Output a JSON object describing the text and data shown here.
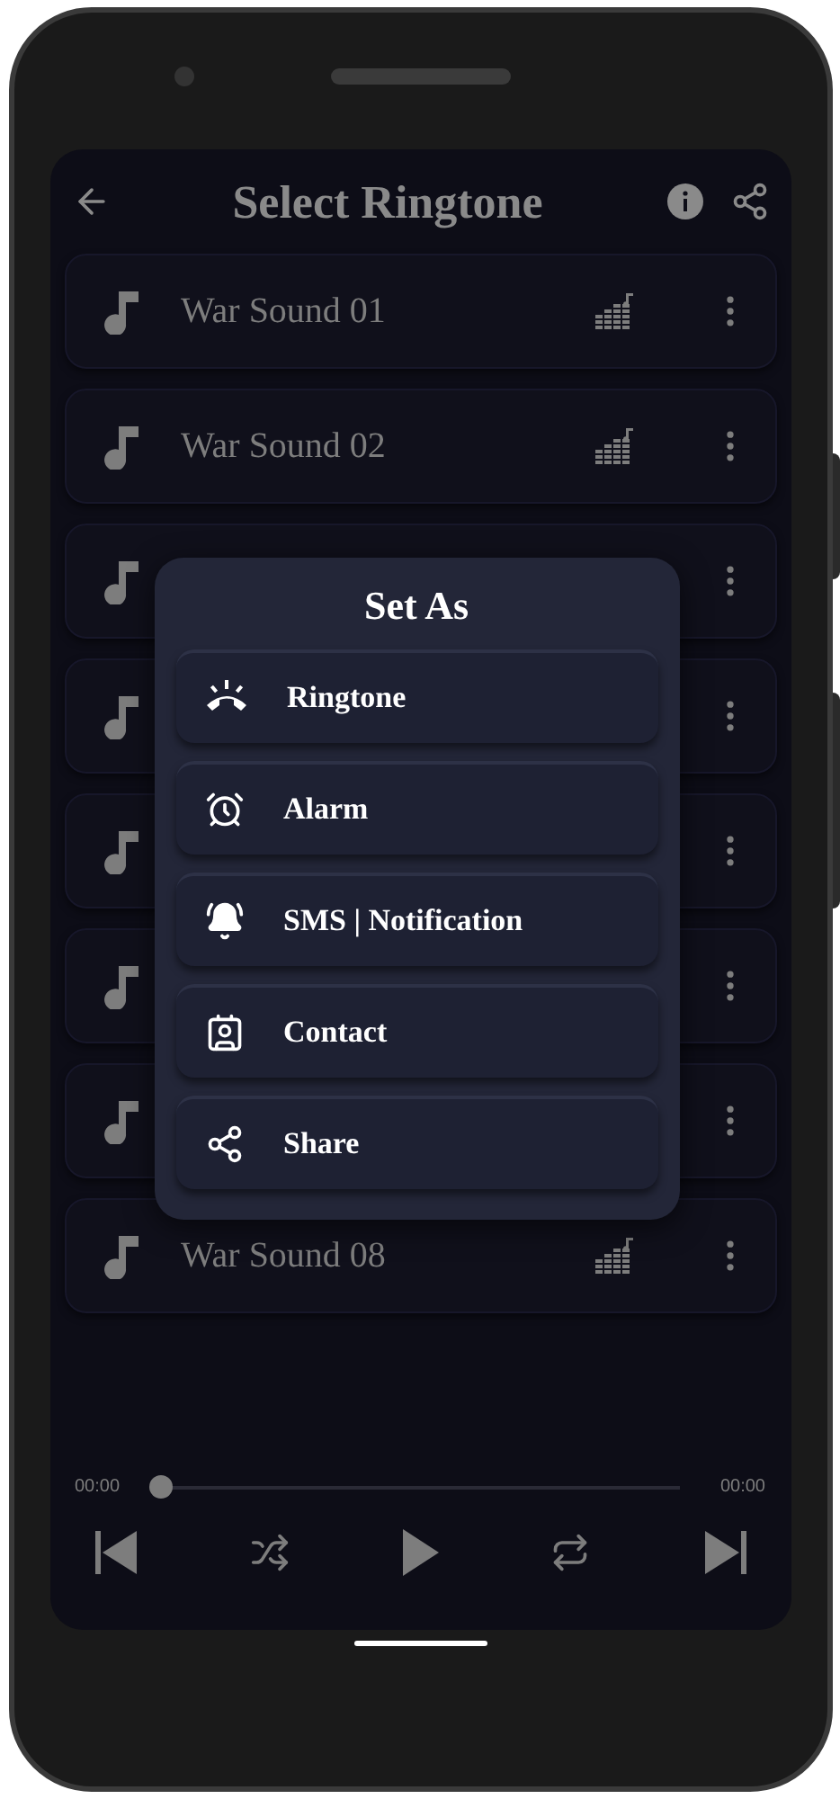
{
  "header": {
    "title": "Select Ringtone"
  },
  "rows": [
    {
      "name": "War Sound 01"
    },
    {
      "name": "War Sound 02"
    },
    {},
    {},
    {},
    {},
    {},
    {
      "name": "War Sound 08"
    }
  ],
  "dialog": {
    "title": "Set As",
    "options": [
      {
        "kind": "ringtone",
        "label": "Ringtone"
      },
      {
        "kind": "alarm",
        "label": "Alarm"
      },
      {
        "kind": "notification",
        "label": "SMS | Notification"
      },
      {
        "kind": "contact",
        "label": "Contact"
      },
      {
        "kind": "share",
        "label": "Share"
      }
    ]
  },
  "player": {
    "elapsed": "00:00",
    "total": "00:00",
    "level": 0
  }
}
